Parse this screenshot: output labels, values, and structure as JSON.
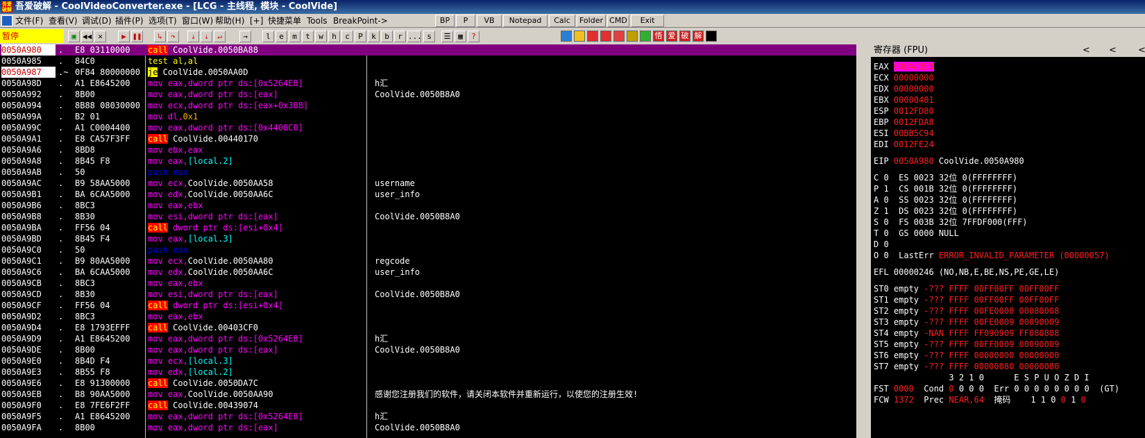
{
  "window": {
    "title": "吾爱破解 - CoolVideoConverter.exe - [LCG - 主线程, 模块 - CoolVide]",
    "logo": "吾爱破解"
  },
  "menu": {
    "items": [
      "文件(F)",
      "查看(V)",
      "调试(D)",
      "插件(P)",
      "选项(T)",
      "窗口(W)",
      "帮助(H)",
      "[+]",
      "快捷菜单",
      "Tools",
      "BreakPoint->"
    ],
    "plugin_buttons": [
      "BP",
      "P",
      "VB",
      "Notepad",
      "Calc",
      "Folder",
      "CMD",
      "Exit"
    ]
  },
  "toolbar": {
    "status": "暂停",
    "letters": [
      "l",
      "e",
      "m",
      "t",
      "w",
      "h",
      "c",
      "P",
      "k",
      "b",
      "r",
      "...",
      "s"
    ],
    "icon_glyphs": [
      "悟",
      "爱",
      "破",
      "解"
    ]
  },
  "disasm": {
    "rows": [
      {
        "addr": "0050A980",
        "mark": ".",
        "hex": "E8 03110000",
        "sel": true,
        "hl": true,
        "dis": [
          {
            "t": "call",
            "c": "call"
          },
          {
            "t": " CoolVide.0050BA88",
            "c": "white"
          }
        ],
        "cmt": ""
      },
      {
        "addr": "0050A985",
        "mark": ".",
        "hex": "84C0",
        "dis": [
          {
            "t": "test al,al",
            "c": "test"
          }
        ],
        "cmt": ""
      },
      {
        "addr": "0050A987",
        "mark": ".~",
        "hex": "0F84 80000000",
        "hl": true,
        "dis": [
          {
            "t": "je",
            "c": "je"
          },
          {
            "t": " CoolVide.0050AA0D",
            "c": "white"
          }
        ],
        "cmt": ""
      },
      {
        "addr": "0050A98D",
        "mark": ".",
        "hex": "A1 E8645200",
        "dis": [
          {
            "t": "mov eax,dword ptr ds:[0x5264E8]",
            "c": "mov"
          }
        ],
        "cmt": "h汇"
      },
      {
        "addr": "0050A992",
        "mark": ".",
        "hex": "8B00",
        "dis": [
          {
            "t": "mov eax,dword ptr ds:[eax]",
            "c": "mov"
          }
        ],
        "cmt": "CoolVide.0050B8A0"
      },
      {
        "addr": "0050A994",
        "mark": ".",
        "hex": "8B88 08030000",
        "dis": [
          {
            "t": "mov ecx,dword ptr ds:[eax+0x308]",
            "c": "mov"
          }
        ],
        "cmt": ""
      },
      {
        "addr": "0050A99A",
        "mark": ".",
        "hex": "B2 01",
        "dis": [
          {
            "t": "mov dl,",
            "c": "mov"
          },
          {
            "t": "0x1",
            "c": "imm"
          }
        ],
        "cmt": ""
      },
      {
        "addr": "0050A99C",
        "mark": ".",
        "hex": "A1 C0004400",
        "dis": [
          {
            "t": "mov eax,dword ptr ds:[0x4400C0]",
            "c": "mov"
          }
        ],
        "cmt": ""
      },
      {
        "addr": "0050A9A1",
        "mark": ".",
        "hex": "E8 CA57F3FF",
        "dis": [
          {
            "t": "call",
            "c": "call"
          },
          {
            "t": " CoolVide.00440170",
            "c": "white"
          }
        ],
        "cmt": ""
      },
      {
        "addr": "0050A9A6",
        "mark": ".",
        "hex": "8BD8",
        "dis": [
          {
            "t": "mov ebx,eax",
            "c": "mov"
          }
        ],
        "cmt": ""
      },
      {
        "addr": "0050A9A8",
        "mark": ".",
        "hex": "8B45 F8",
        "dis": [
          {
            "t": "mov eax,",
            "c": "mov"
          },
          {
            "t": "[local.2]",
            "c": "local"
          }
        ],
        "cmt": ""
      },
      {
        "addr": "0050A9AB",
        "mark": ".",
        "hex": "50",
        "dis": [
          {
            "t": "push eax",
            "c": "push"
          }
        ],
        "cmt": ""
      },
      {
        "addr": "0050A9AC",
        "mark": ".",
        "hex": "B9 58AA5000",
        "dis": [
          {
            "t": "mov ecx,",
            "c": "mov"
          },
          {
            "t": "CoolVide.0050AA58",
            "c": "white"
          }
        ],
        "cmt": "username"
      },
      {
        "addr": "0050A9B1",
        "mark": ".",
        "hex": "BA 6CAA5000",
        "dis": [
          {
            "t": "mov edx,",
            "c": "mov"
          },
          {
            "t": "CoolVide.0050AA6C",
            "c": "white"
          }
        ],
        "cmt": "user_info"
      },
      {
        "addr": "0050A9B6",
        "mark": ".",
        "hex": "8BC3",
        "dis": [
          {
            "t": "mov eax,ebx",
            "c": "mov"
          }
        ],
        "cmt": ""
      },
      {
        "addr": "0050A9B8",
        "mark": ".",
        "hex": "8B30",
        "dis": [
          {
            "t": "mov esi,dword ptr ds:[eax]",
            "c": "mov"
          }
        ],
        "cmt": "CoolVide.0050B8A0"
      },
      {
        "addr": "0050A9BA",
        "mark": ".",
        "hex": "FF56 04",
        "dis": [
          {
            "t": "call",
            "c": "call"
          },
          {
            "t": " dword ptr ds:[esi+0x4]",
            "c": "mov"
          }
        ],
        "cmt": ""
      },
      {
        "addr": "0050A9BD",
        "mark": ".",
        "hex": "8B45 F4",
        "dis": [
          {
            "t": "mov eax,",
            "c": "mov"
          },
          {
            "t": "[local.3]",
            "c": "local"
          }
        ],
        "cmt": ""
      },
      {
        "addr": "0050A9C0",
        "mark": ".",
        "hex": "50",
        "dis": [
          {
            "t": "push eax",
            "c": "push"
          }
        ],
        "cmt": ""
      },
      {
        "addr": "0050A9C1",
        "mark": ".",
        "hex": "B9 80AA5000",
        "dis": [
          {
            "t": "mov ecx,",
            "c": "mov"
          },
          {
            "t": "CoolVide.0050AA80",
            "c": "white"
          }
        ],
        "cmt": "regcode"
      },
      {
        "addr": "0050A9C6",
        "mark": ".",
        "hex": "BA 6CAA5000",
        "dis": [
          {
            "t": "mov edx,",
            "c": "mov"
          },
          {
            "t": "CoolVide.0050AA6C",
            "c": "white"
          }
        ],
        "cmt": "user_info"
      },
      {
        "addr": "0050A9CB",
        "mark": ".",
        "hex": "8BC3",
        "dis": [
          {
            "t": "mov eax,ebx",
            "c": "mov"
          }
        ],
        "cmt": ""
      },
      {
        "addr": "0050A9CD",
        "mark": ".",
        "hex": "8B30",
        "dis": [
          {
            "t": "mov esi,dword ptr ds:[eax]",
            "c": "mov"
          }
        ],
        "cmt": "CoolVide.0050B8A0"
      },
      {
        "addr": "0050A9CF",
        "mark": ".",
        "hex": "FF56 04",
        "dis": [
          {
            "t": "call",
            "c": "call"
          },
          {
            "t": " dword ptr ds:[esi+0x4]",
            "c": "mov"
          }
        ],
        "cmt": ""
      },
      {
        "addr": "0050A9D2",
        "mark": ".",
        "hex": "8BC3",
        "dis": [
          {
            "t": "mov eax,ebx",
            "c": "mov"
          }
        ],
        "cmt": ""
      },
      {
        "addr": "0050A9D4",
        "mark": ".",
        "hex": "E8 1793EFFF",
        "dis": [
          {
            "t": "call",
            "c": "call"
          },
          {
            "t": " CoolVide.00403CF0",
            "c": "white"
          }
        ],
        "cmt": ""
      },
      {
        "addr": "0050A9D9",
        "mark": ".",
        "hex": "A1 E8645200",
        "dis": [
          {
            "t": "mov eax,dword ptr ds:[0x5264E8]",
            "c": "mov"
          }
        ],
        "cmt": "h汇"
      },
      {
        "addr": "0050A9DE",
        "mark": ".",
        "hex": "8B00",
        "dis": [
          {
            "t": "mov eax,dword ptr ds:[eax]",
            "c": "mov"
          }
        ],
        "cmt": "CoolVide.0050B8A0"
      },
      {
        "addr": "0050A9E0",
        "mark": ".",
        "hex": "8B4D F4",
        "dis": [
          {
            "t": "mov ecx,",
            "c": "mov"
          },
          {
            "t": "[local.3]",
            "c": "local"
          }
        ],
        "cmt": ""
      },
      {
        "addr": "0050A9E3",
        "mark": ".",
        "hex": "8B55 F8",
        "dis": [
          {
            "t": "mov edx,",
            "c": "mov"
          },
          {
            "t": "[local.2]",
            "c": "local"
          }
        ],
        "cmt": ""
      },
      {
        "addr": "0050A9E6",
        "mark": ".",
        "hex": "E8 91300000",
        "dis": [
          {
            "t": "call",
            "c": "call"
          },
          {
            "t": " CoolVide.0050DA7C",
            "c": "white"
          }
        ],
        "cmt": ""
      },
      {
        "addr": "0050A9EB",
        "mark": ".",
        "hex": "B8 90AA5000",
        "dis": [
          {
            "t": "mov eax,",
            "c": "mov"
          },
          {
            "t": "CoolVide.0050AA90",
            "c": "white"
          }
        ],
        "cmt": "感谢您注册我们的软件，请关闭本软件并重新运行，以使您的注册生效!"
      },
      {
        "addr": "0050A9F0",
        "mark": ".",
        "hex": "E8 7FE6F2FF",
        "dis": [
          {
            "t": "call",
            "c": "call"
          },
          {
            "t": " CoolVide.00439074",
            "c": "white"
          }
        ],
        "cmt": ""
      },
      {
        "addr": "0050A9F5",
        "mark": ".",
        "hex": "A1 E8645200",
        "dis": [
          {
            "t": "mov eax,dword ptr ds:[0x5264E8]",
            "c": "mov"
          }
        ],
        "cmt": "h汇"
      },
      {
        "addr": "0050A9FA",
        "mark": ".",
        "hex": "8B00",
        "dis": [
          {
            "t": "mov eax,dword ptr ds:[eax]",
            "c": "mov"
          }
        ],
        "cmt": "CoolVide.0050B8A0"
      }
    ]
  },
  "registers": {
    "header": "寄存器 (FPU)",
    "arrows": [
      "<",
      "<",
      "<"
    ],
    "lines": [
      {
        "p": [
          {
            "t": "EAX ",
            "c": "w"
          },
          {
            "t": "00BAABE0",
            "c": "hl"
          }
        ]
      },
      {
        "p": [
          {
            "t": "ECX ",
            "c": "w"
          },
          {
            "t": "00000000",
            "c": "r"
          }
        ]
      },
      {
        "p": [
          {
            "t": "EDX ",
            "c": "w"
          },
          {
            "t": "00000000",
            "c": "r"
          }
        ]
      },
      {
        "p": [
          {
            "t": "EBX ",
            "c": "w"
          },
          {
            "t": "00000401",
            "c": "r"
          }
        ]
      },
      {
        "p": [
          {
            "t": "ESP ",
            "c": "w"
          },
          {
            "t": "0012FD80",
            "c": "r"
          }
        ]
      },
      {
        "p": [
          {
            "t": "EBP ",
            "c": "w"
          },
          {
            "t": "0012FDA8",
            "c": "r"
          }
        ]
      },
      {
        "p": [
          {
            "t": "ESI ",
            "c": "w"
          },
          {
            "t": "00BB5C94",
            "c": "r"
          }
        ]
      },
      {
        "p": [
          {
            "t": "EDI ",
            "c": "w"
          },
          {
            "t": "0012FE24",
            "c": "r"
          }
        ]
      },
      {
        "gap": true
      },
      {
        "p": [
          {
            "t": "EIP ",
            "c": "w"
          },
          {
            "t": "0050A980",
            "c": "r"
          },
          {
            "t": " CoolVide.0050A980",
            "c": "w"
          }
        ]
      },
      {
        "gap": true
      },
      {
        "p": [
          {
            "t": "C 0  ES 0023 32位 0(FFFFFFFF)",
            "c": "w"
          }
        ]
      },
      {
        "p": [
          {
            "t": "P 1  CS 001B 32位 0(FFFFFFFF)",
            "c": "w"
          }
        ]
      },
      {
        "p": [
          {
            "t": "A 0  SS 0023 32位 0(FFFFFFFF)",
            "c": "w"
          }
        ]
      },
      {
        "p": [
          {
            "t": "Z 1  DS 0023 32位 0(FFFFFFFF)",
            "c": "w"
          }
        ]
      },
      {
        "p": [
          {
            "t": "S 0  FS 003B 32位 7FFDF000(FFF)",
            "c": "w"
          }
        ]
      },
      {
        "p": [
          {
            "t": "T 0  GS 0000 NULL",
            "c": "w"
          }
        ]
      },
      {
        "p": [
          {
            "t": "D 0",
            "c": "w"
          }
        ]
      },
      {
        "p": [
          {
            "t": "O 0  LastErr ",
            "c": "w"
          },
          {
            "t": "ERROR_INVALID_PARAMETER (00000057)",
            "c": "r"
          }
        ]
      },
      {
        "gap": true
      },
      {
        "p": [
          {
            "t": "EFL 00000246 (NO,NB,E,BE,NS,PE,GE,LE)",
            "c": "w"
          }
        ]
      },
      {
        "gap": true
      },
      {
        "p": [
          {
            "t": "ST0 empty ",
            "c": "w"
          },
          {
            "t": "-??? FFFF 00FF00FF 00FF00FF",
            "c": "r"
          }
        ]
      },
      {
        "p": [
          {
            "t": "ST1 empty ",
            "c": "w"
          },
          {
            "t": "-??? FFFF 00FF00FF 00FF00FF",
            "c": "r"
          }
        ]
      },
      {
        "p": [
          {
            "t": "ST2 empty ",
            "c": "w"
          },
          {
            "t": "-??? FFFF 00FE0008 00080008",
            "c": "r"
          }
        ]
      },
      {
        "p": [
          {
            "t": "ST3 empty ",
            "c": "w"
          },
          {
            "t": "-??? FFFF 00FE0009 00090009",
            "c": "r"
          }
        ]
      },
      {
        "p": [
          {
            "t": "ST4 empty ",
            "c": "w"
          },
          {
            "t": "-NAN FFFF FF090909 FF080808",
            "c": "r"
          }
        ]
      },
      {
        "p": [
          {
            "t": "ST5 empty ",
            "c": "w"
          },
          {
            "t": "-??? FFFF 00FF0009 00090009",
            "c": "r"
          }
        ]
      },
      {
        "p": [
          {
            "t": "ST6 empty ",
            "c": "w"
          },
          {
            "t": "-??? FFFF 00000000 00000000",
            "c": "r"
          }
        ]
      },
      {
        "p": [
          {
            "t": "ST7 empty ",
            "c": "w"
          },
          {
            "t": "-??? FFFF 00000080 00000080",
            "c": "r"
          }
        ]
      },
      {
        "p": [
          {
            "t": "               3 2 1 0      E S P U O Z D I",
            "c": "w"
          }
        ]
      },
      {
        "p": [
          {
            "t": "FST ",
            "c": "w"
          },
          {
            "t": "0000",
            "c": "r"
          },
          {
            "t": "  Cond ",
            "c": "w"
          },
          {
            "t": "0",
            "c": "r"
          },
          {
            "t": " 0 0 0  Err 0 0 0 0 0 0 0 0  (GT)",
            "c": "w"
          }
        ]
      },
      {
        "p": [
          {
            "t": "FCW ",
            "c": "w"
          },
          {
            "t": "1372",
            "c": "r"
          },
          {
            "t": "  Prec ",
            "c": "w"
          },
          {
            "t": "NEAR,64",
            "c": "r"
          },
          {
            "t": "  掩码    1 1 0 ",
            "c": "w"
          },
          {
            "t": "0",
            "c": "r"
          },
          {
            "t": " 1 ",
            "c": "w"
          },
          {
            "t": "0",
            "c": "r"
          }
        ]
      }
    ]
  }
}
